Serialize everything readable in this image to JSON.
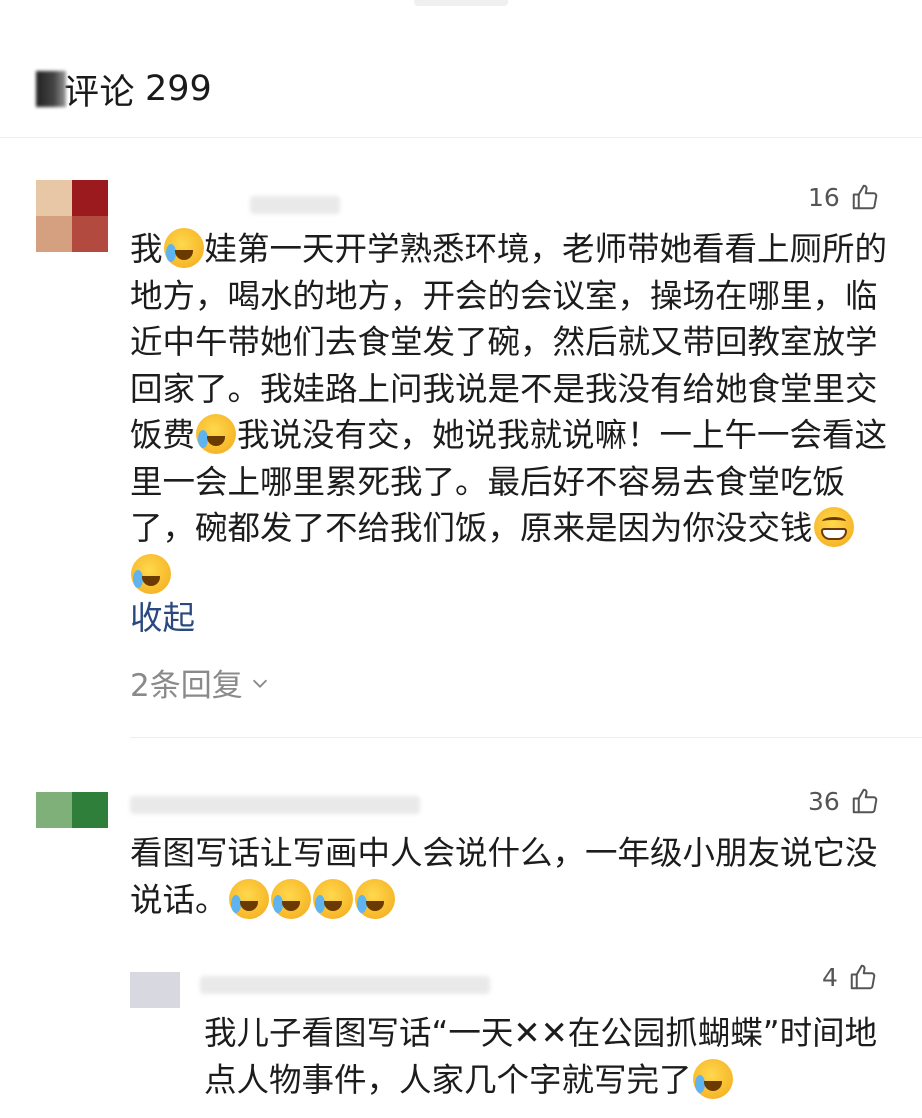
{
  "header": {
    "title": "评论",
    "count": "299"
  },
  "comments": [
    {
      "likes": "16",
      "text_parts": [
        "我",
        "[cry]",
        "娃第一天开学熟悉环境，老师带她看看上厕所的地方，喝水的地方，开会的会议室，操场在哪里，临近中午带她们去食堂发了碗，然后就又带回教室放学回家了。我娃路上问我说是不是我没有给她食堂里交饭费",
        "[cry]",
        "我说没有交，她说我就说嘛！一上午一会看这里一会上哪里累死我了。最后好不容易去食堂吃饭了，碗都发了不给我们饭，原来是因为你没交钱",
        "[grin]",
        "[cry]"
      ],
      "collapse_label": "收起",
      "replies_label": "2条回复"
    },
    {
      "likes": "36",
      "text": "看图写话让写画中人会说什么，一年级小朋友说它没说话。",
      "emojis": [
        "[cry]",
        "[cry]",
        "[cry]",
        "[cry]"
      ]
    },
    {
      "likes": "4",
      "text": "我儿子看图写话“一天✕✕在公园抓蝴蝶”时间地点人物事件，人家几个字就写完了",
      "emojis": [
        "[cry]"
      ]
    }
  ],
  "icons": {
    "like": "thumbs-up-icon",
    "chevron": "chevron-down-icon"
  },
  "colors": {
    "link": "#2a4a7f",
    "muted": "#8a8a8a",
    "divider": "#ededed"
  }
}
